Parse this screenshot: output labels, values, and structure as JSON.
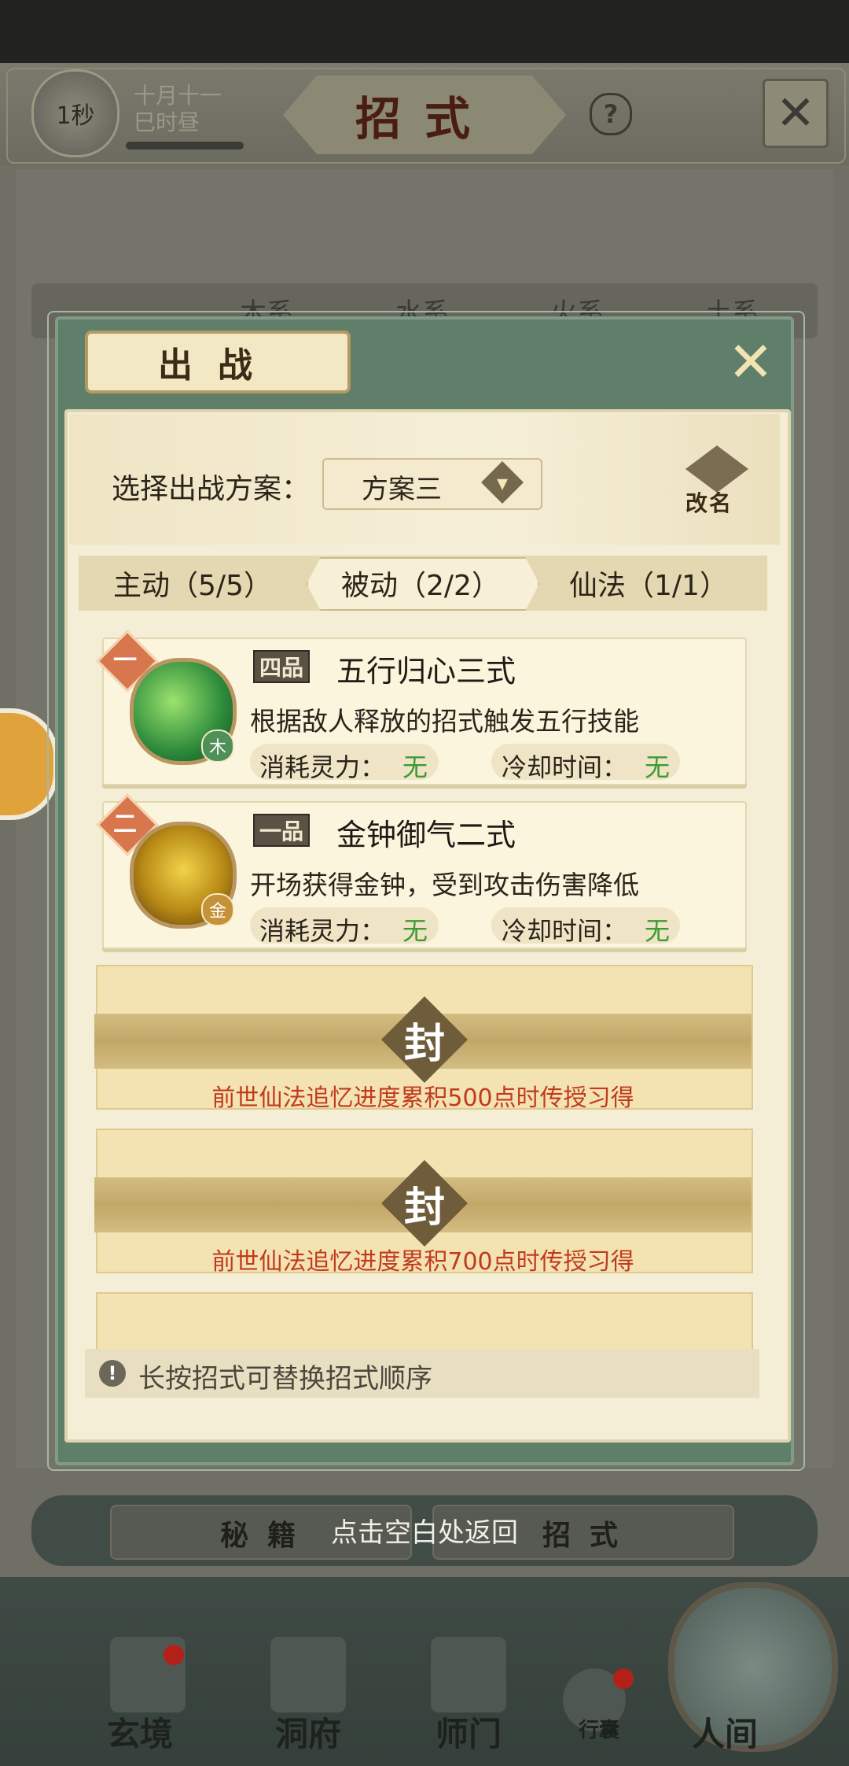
{
  "background": {
    "timer": "1秒",
    "date_line1": "十月十一",
    "date_line2": "巳时昼",
    "title": "招式",
    "help": "?",
    "element_tabs": [
      "木系",
      "水系",
      "火系",
      "土系"
    ]
  },
  "modal": {
    "title": "出战",
    "scheme_label": "选择出战方案：",
    "scheme_value": "方案三",
    "rename_label": "改名",
    "tabs": [
      {
        "label": "主动（5/5）",
        "active": false
      },
      {
        "label": "被动（2/2）",
        "active": true
      },
      {
        "label": "仙法（1/1）",
        "active": false
      }
    ],
    "skills": [
      {
        "order": "一",
        "grade": "四品",
        "name": "五行归心三式",
        "element": "木",
        "description": "根据敌人释放的招式触发五行技能",
        "cost_label": "消耗灵力：",
        "cost_value": "无",
        "cooldown_label": "冷却时间：",
        "cooldown_value": "无"
      },
      {
        "order": "二",
        "grade": "一品",
        "name": "金钟御气二式",
        "element": "金",
        "description": "开场获得金钟，受到攻击伤害降低",
        "cost_label": "消耗灵力：",
        "cost_value": "无",
        "cooldown_label": "冷却时间：",
        "cooldown_value": "无"
      }
    ],
    "locked_slots": [
      {
        "seal": "封",
        "requirement": "前世仙法追忆进度累积500点时传授习得"
      },
      {
        "seal": "封",
        "requirement": "前世仙法追忆进度累积700点时传授习得"
      }
    ],
    "tip": "长按招式可替换招式顺序"
  },
  "return_hint": "点击空白处返回",
  "bottom_tabs": [
    "秘籍",
    "招式"
  ],
  "nav": [
    "玄境",
    "洞府",
    "师门",
    "行囊",
    "人间"
  ]
}
